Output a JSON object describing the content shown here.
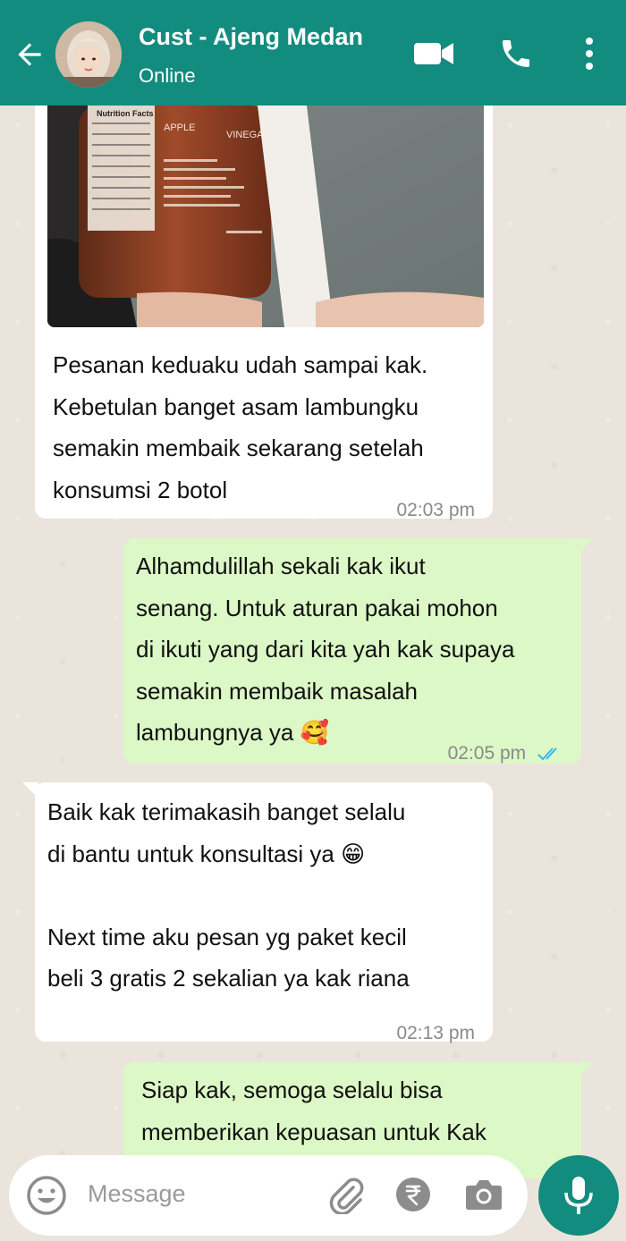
{
  "header": {
    "contact_name": "Cust - Ajeng Medan",
    "status": "Online",
    "icons": [
      "back-arrow-icon",
      "video-call-icon",
      "voice-call-icon",
      "more-options-icon"
    ]
  },
  "messages": [
    {
      "direction": "in",
      "has_image": true,
      "image_text": {
        "label_1": "APPLE",
        "label_2": "VINEGAR",
        "nutrition": "Nutrition Facts"
      },
      "text": "Pesanan keduaku udah sampai kak.\nKebetulan banget asam lambungku\nsemakin membaik sekarang setelah\nkonsumsi 2 botol",
      "time": "02:03 pm"
    },
    {
      "direction": "out",
      "text": "Alhamdulillah sekali kak ikut\nsenang. Untuk aturan pakai mohon\ndi ikuti yang dari kita yah kak supaya\nsemakin membaik masalah\nlambungnya ya 🥰",
      "time": "02:05 pm",
      "read": true
    },
    {
      "direction": "in",
      "text": "Baik kak terimakasih banget selalu\ndi bantu untuk konsultasi ya 😁\n\nNext time aku pesan yg paket kecil\nbeli 3 gratis 2 sekalian ya kak riana",
      "time": "02:13 pm"
    },
    {
      "direction": "out",
      "text": "Siap kak, semoga selalu bisa\nmemberikan kepuasan untuk Kak",
      "time": ""
    }
  ],
  "input": {
    "placeholder": "Message"
  },
  "colors": {
    "header": "#128c7e",
    "outgoing_bubble": "#dcf8c6",
    "incoming_bubble": "#ffffff",
    "read_ticks": "#34b7f1"
  }
}
